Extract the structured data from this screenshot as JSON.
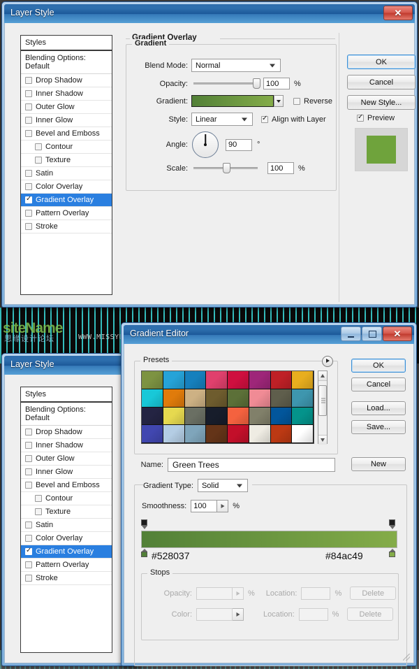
{
  "watermark": {
    "site": "siteName",
    "chinese": "思缘设计论坛",
    "url": "WWW.MISSYUAN.COM"
  },
  "layer_style_dialog": {
    "title": "Layer Style",
    "close_label": "✕",
    "styles_header": "Styles",
    "blending_options": "Blending Options: Default",
    "effects": [
      {
        "label": "Drop Shadow",
        "checked": false,
        "indent": false,
        "selected": false
      },
      {
        "label": "Inner Shadow",
        "checked": false,
        "indent": false,
        "selected": false
      },
      {
        "label": "Outer Glow",
        "checked": false,
        "indent": false,
        "selected": false
      },
      {
        "label": "Inner Glow",
        "checked": false,
        "indent": false,
        "selected": false
      },
      {
        "label": "Bevel and Emboss",
        "checked": false,
        "indent": false,
        "selected": false
      },
      {
        "label": "Contour",
        "checked": false,
        "indent": true,
        "selected": false
      },
      {
        "label": "Texture",
        "checked": false,
        "indent": true,
        "selected": false
      },
      {
        "label": "Satin",
        "checked": false,
        "indent": false,
        "selected": false
      },
      {
        "label": "Color Overlay",
        "checked": false,
        "indent": false,
        "selected": false
      },
      {
        "label": "Gradient Overlay",
        "checked": true,
        "indent": false,
        "selected": true
      },
      {
        "label": "Pattern Overlay",
        "checked": false,
        "indent": false,
        "selected": false
      },
      {
        "label": "Stroke",
        "checked": false,
        "indent": false,
        "selected": false
      }
    ],
    "panel": {
      "section_title": "Gradient Overlay",
      "group_title": "Gradient",
      "blend_mode_label": "Blend Mode:",
      "blend_mode_value": "Normal",
      "opacity_label": "Opacity:",
      "opacity_value": "100",
      "opacity_unit": "%",
      "gradient_label": "Gradient:",
      "gradient_start": "#528037",
      "gradient_end": "#84ac49",
      "reverse_label": "Reverse",
      "reverse_checked": false,
      "style_label": "Style:",
      "style_value": "Linear",
      "align_label": "Align with Layer",
      "align_checked": true,
      "angle_label": "Angle:",
      "angle_value": "90",
      "angle_unit": "°",
      "scale_label": "Scale:",
      "scale_value": "100",
      "scale_unit": "%"
    },
    "buttons": {
      "ok": "OK",
      "cancel": "Cancel",
      "new_style": "New Style...",
      "preview_label": "Preview",
      "preview_checked": true,
      "preview_color": "#6fa33c"
    }
  },
  "layer_style_dialog2": {
    "title": "Layer Style",
    "styles_header": "Styles",
    "blending_options": "Blending Options: Default",
    "effects": [
      {
        "label": "Drop Shadow",
        "checked": false,
        "indent": false,
        "selected": false
      },
      {
        "label": "Inner Shadow",
        "checked": false,
        "indent": false,
        "selected": false
      },
      {
        "label": "Outer Glow",
        "checked": false,
        "indent": false,
        "selected": false
      },
      {
        "label": "Inner Glow",
        "checked": false,
        "indent": false,
        "selected": false
      },
      {
        "label": "Bevel and Emboss",
        "checked": false,
        "indent": false,
        "selected": false
      },
      {
        "label": "Contour",
        "checked": false,
        "indent": true,
        "selected": false
      },
      {
        "label": "Texture",
        "checked": false,
        "indent": true,
        "selected": false
      },
      {
        "label": "Satin",
        "checked": false,
        "indent": false,
        "selected": false
      },
      {
        "label": "Color Overlay",
        "checked": false,
        "indent": false,
        "selected": false
      },
      {
        "label": "Gradient Overlay",
        "checked": true,
        "indent": false,
        "selected": true
      },
      {
        "label": "Pattern Overlay",
        "checked": false,
        "indent": false,
        "selected": false
      },
      {
        "label": "Stroke",
        "checked": false,
        "indent": false,
        "selected": false
      }
    ]
  },
  "gradient_editor": {
    "title": "Gradient Editor",
    "minimize_label": "—",
    "maximize_label": "▢",
    "close_label": "✕",
    "presets_legend": "Presets",
    "presets": [
      "#7d9342",
      "#26a3d8",
      "#1680bd",
      "#e0406d",
      "#cf0f3f",
      "#9e2679",
      "#bf2026",
      "#e8ae1e",
      "#18c8d8",
      "#e07b0b",
      "#cdb184",
      "#6e5c2e",
      "#5c7038",
      "#f08b95",
      "#5f5e4c",
      "#3e96ae",
      "#242443",
      "#e6d94f",
      "#6a6f63",
      "#171d2b",
      "#f4623f",
      "#81806a",
      "#02569b",
      "#04938b",
      "#4147b0",
      "#b4cde4",
      "#7fa5bb",
      "#643418",
      "#c30f2a",
      "#efece3",
      "#bc3913",
      "#ffffff"
    ],
    "buttons": {
      "ok": "OK",
      "cancel": "Cancel",
      "load": "Load...",
      "save": "Save...",
      "new": "New"
    },
    "name_label": "Name:",
    "name_value": "Green Trees",
    "gradient_type_label": "Gradient Type:",
    "gradient_type_value": "Solid",
    "smoothness_label": "Smoothness:",
    "smoothness_value": "100",
    "smoothness_unit": "%",
    "gradient_start_hex": "#528037",
    "gradient_end_hex": "#84ac49",
    "stops_legend": "Stops",
    "opacity_label": "Opacity:",
    "opacity_value": "",
    "opacity_unit": "%",
    "color_label": "Color:",
    "location_label_1": "Location:",
    "location_label_2": "Location:",
    "location_value_1": "",
    "location_value_2": "",
    "location_unit_1": "%",
    "location_unit_2": "%",
    "delete_label_1": "Delete",
    "delete_label_2": "Delete"
  }
}
